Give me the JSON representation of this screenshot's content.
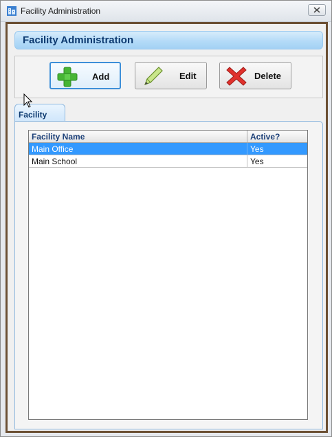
{
  "window": {
    "title": "Facility Administration",
    "close_symbol": "✕",
    "icon": "app-icon"
  },
  "header": {
    "title": "Facility Administration"
  },
  "toolbar": {
    "add_label": "Add",
    "edit_label": "Edit",
    "delete_label": "Delete",
    "add_icon": "plus-icon",
    "edit_icon": "pencil-icon",
    "delete_icon": "x-icon"
  },
  "tabs": [
    {
      "label": "Facility",
      "selected": true
    }
  ],
  "grid": {
    "columns": [
      "Facility Name",
      "Active?"
    ],
    "rows": [
      {
        "name": "Main Office",
        "active": "Yes",
        "selected": true
      },
      {
        "name": "Main School",
        "active": "Yes",
        "selected": false
      }
    ]
  },
  "colors": {
    "selection": "#3399ff",
    "header_text": "#0d3a70",
    "frame_border": "#6b4f33",
    "add_green": "#46b535",
    "delete_red": "#e0312c"
  }
}
